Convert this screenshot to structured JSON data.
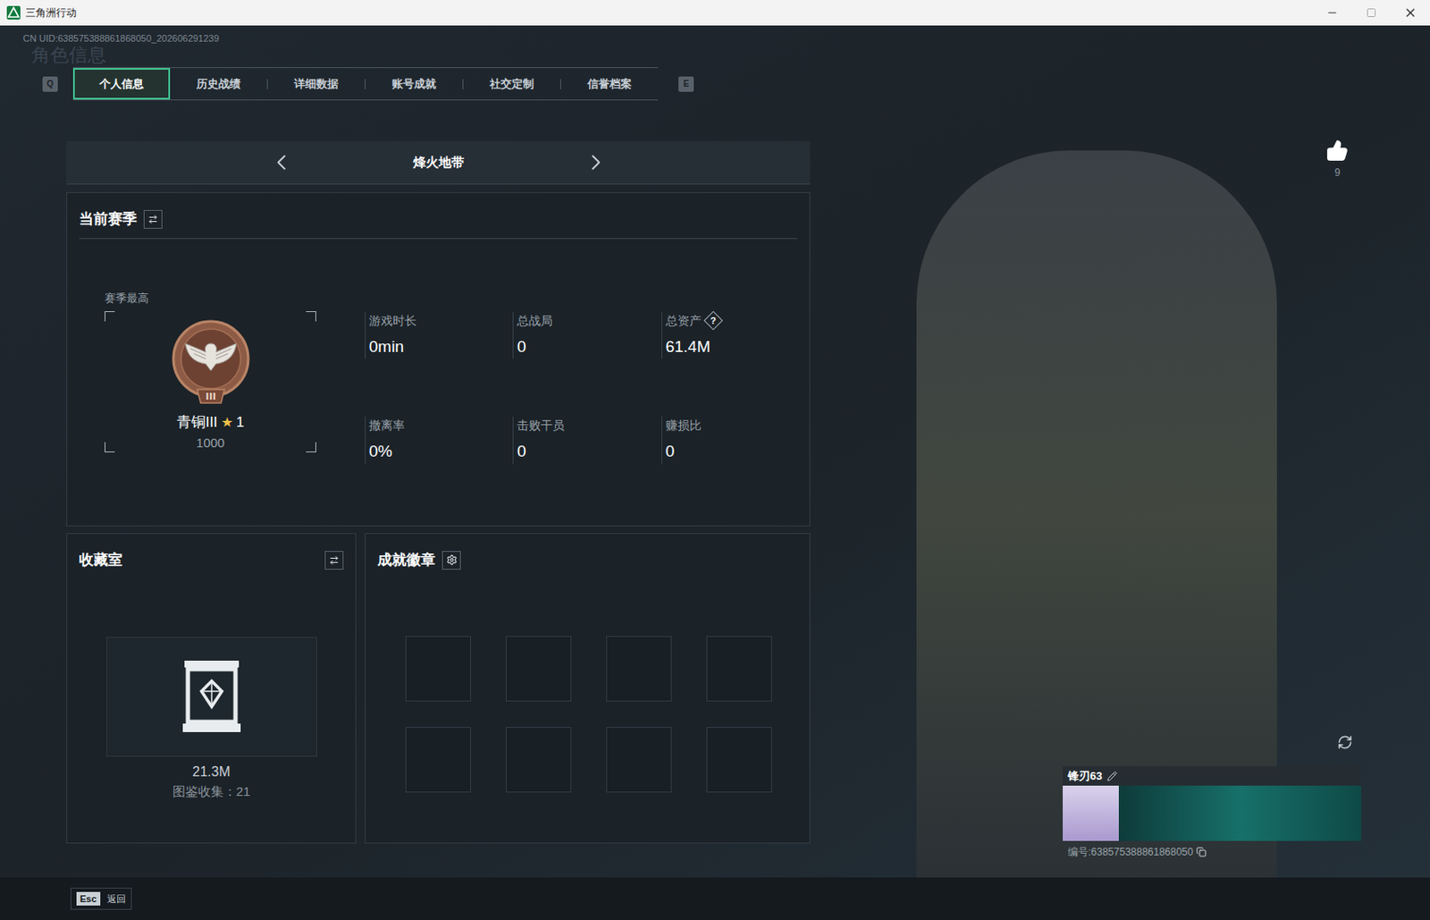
{
  "window": {
    "title": "三角洲行动"
  },
  "uid": "CN UID:638575388861868050_202606291239",
  "watermark": "角色信息",
  "tabs": {
    "prev_key": "Q",
    "next_key": "E",
    "items": [
      {
        "label": "个人信息",
        "selected": true
      },
      {
        "label": "历史战绩",
        "selected": false
      },
      {
        "label": "详细数据",
        "selected": false
      },
      {
        "label": "账号成就",
        "selected": false
      },
      {
        "label": "社交定制",
        "selected": false
      },
      {
        "label": "信誉档案",
        "selected": false
      }
    ]
  },
  "mode": {
    "label": "烽火地带"
  },
  "season": {
    "title": "当前赛季",
    "best_label": "赛季最高",
    "emblem_numeral": "III",
    "rank": "青铜III",
    "star": "★",
    "stars_count": "1",
    "score": "1000",
    "stats": [
      {
        "label": "游戏时长",
        "value": "0min"
      },
      {
        "label": "总战局",
        "value": "0"
      },
      {
        "label": "总资产",
        "value": "61.4M",
        "help": "?"
      },
      {
        "label": "撤离率",
        "value": "0%"
      },
      {
        "label": "击败干员",
        "value": "0"
      },
      {
        "label": "赚损比",
        "value": "0"
      }
    ]
  },
  "collection": {
    "title": "收藏室",
    "value": "21.3M",
    "caption": "图鉴收集：21"
  },
  "badges": {
    "title": "成就徽章",
    "slots": [
      {
        "filled": false
      },
      {
        "filled": false
      },
      {
        "filled": false
      },
      {
        "filled": false
      },
      {
        "filled": false
      },
      {
        "filled": false
      },
      {
        "filled": false
      },
      {
        "filled": false
      }
    ]
  },
  "likes": {
    "count": "9"
  },
  "player": {
    "name": "锋刃63",
    "id": "编号:638575388861868050"
  },
  "footer": {
    "key": "Esc",
    "label": "返回"
  }
}
